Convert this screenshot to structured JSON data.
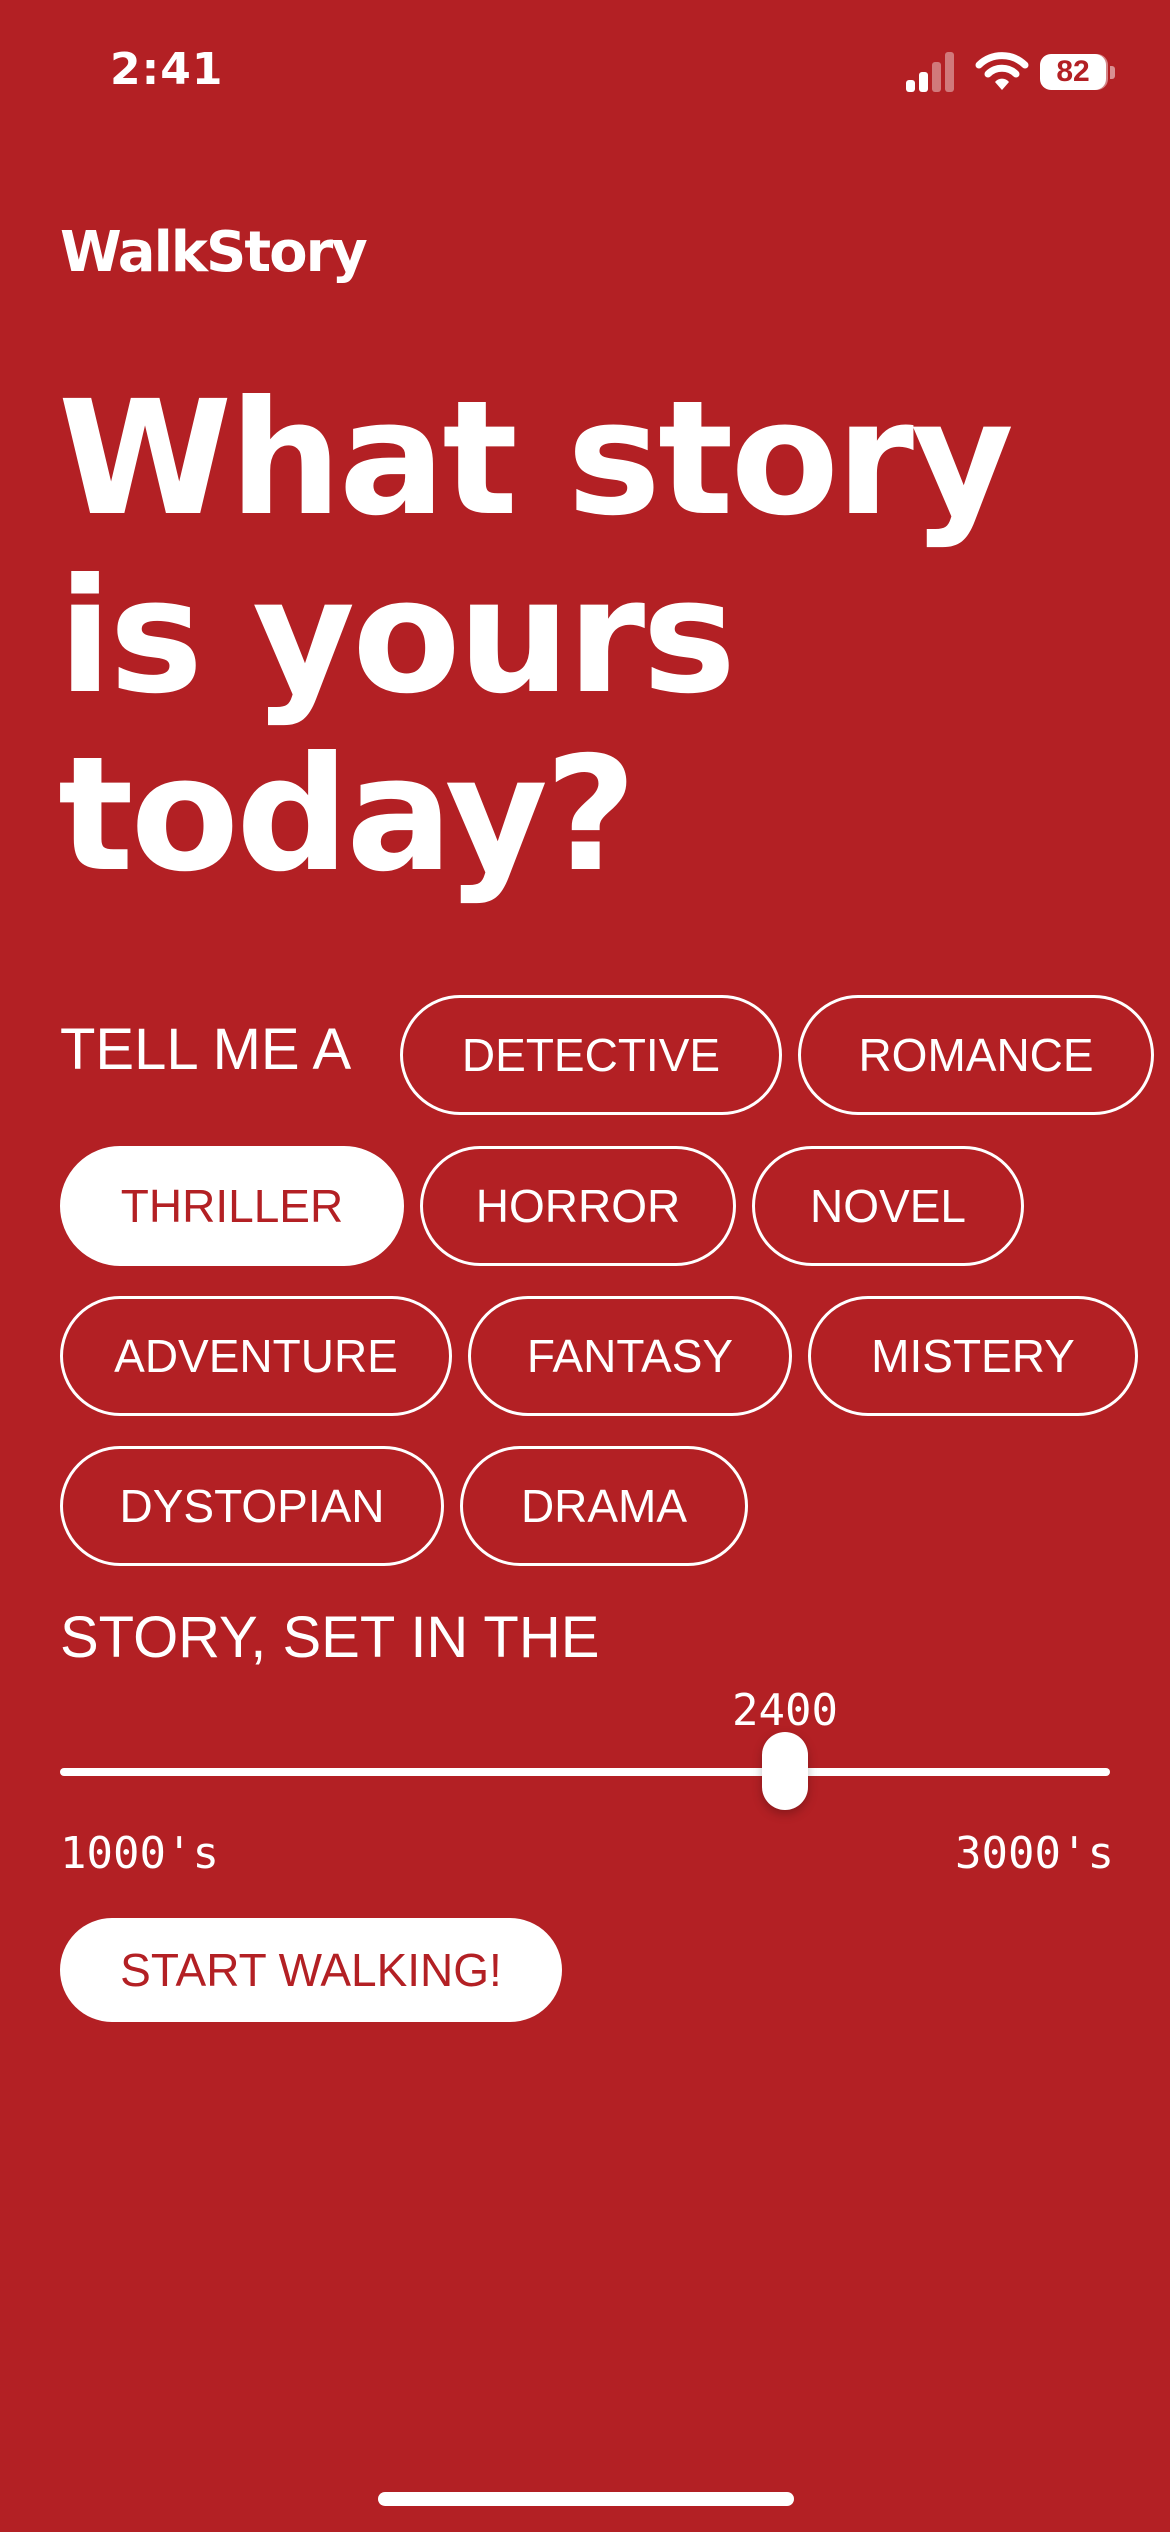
{
  "colors": {
    "background": "#b32024",
    "foreground": "#ffffff",
    "accent_text": "#b32024"
  },
  "status_bar": {
    "time": "2:41",
    "battery": "82",
    "icons": [
      "signal-icon",
      "wifi-icon",
      "battery-icon"
    ]
  },
  "brand": {
    "name": "WalkStory"
  },
  "headline": {
    "lines": [
      "What story",
      "is yours",
      "today?"
    ]
  },
  "genre": {
    "prefix": "TELL ME A",
    "options": [
      {
        "label": "DETECTIVE",
        "selected": false
      },
      {
        "label": "ROMANCE",
        "selected": false
      },
      {
        "label": "THRILLER",
        "selected": true
      },
      {
        "label": "HORROR",
        "selected": false
      },
      {
        "label": "NOVEL",
        "selected": false
      },
      {
        "label": "ADVENTURE",
        "selected": false
      },
      {
        "label": "FANTASY",
        "selected": false
      },
      {
        "label": "MISTERY",
        "selected": false
      },
      {
        "label": "DYSTOPIAN",
        "selected": false
      },
      {
        "label": "DRAMA",
        "selected": false
      }
    ]
  },
  "era": {
    "prefix": "STORY, SET IN THE",
    "value": "2400",
    "min_label": "1000's",
    "max_label": "3000's",
    "min": 1000,
    "max": 3000,
    "current": 2400
  },
  "cta": {
    "label": "START WALKING!"
  }
}
